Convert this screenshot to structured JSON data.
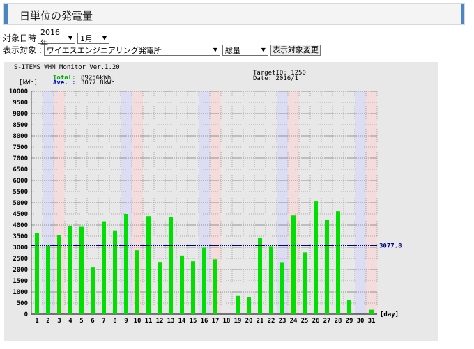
{
  "page": {
    "title": "日単位の発電量"
  },
  "controls": {
    "period_label": "対象日時",
    "year_value": "2016年",
    "month_value": "1月",
    "target_label": "表示対象 :",
    "target_value": "ワイエスエンジニアリング発電所",
    "kind_value": "総量",
    "change_button": "表示対象変更"
  },
  "chart_header": {
    "app": "S-ITEMS WHM Monitor Ver.1.20",
    "unit": "[kWh]",
    "total_label": "Total:",
    "total_value": "89256kWh",
    "ave_label": "Ave.  :",
    "ave_value": "3077.8kWh",
    "target_id": "TargetID: 1250",
    "date": "Date: 2016/1"
  },
  "colors": {
    "bar": "#00e000",
    "saturday": "#dcdcf2",
    "sunday": "#f4dcdc",
    "average_line": "#000080",
    "accent": "#4a86c5"
  },
  "chart_data": {
    "type": "bar",
    "xlabel": "[day]",
    "ylabel": "[kWh]",
    "ylim": [
      0,
      10000
    ],
    "yticks": [
      "0",
      "500",
      "1000",
      "1500",
      "2000",
      "2500",
      "3000",
      "3500",
      "4000",
      "4500",
      "5000",
      "5500",
      "6000",
      "6500",
      "7000",
      "7500",
      "8000",
      "8500",
      "9000",
      "9500",
      "10000"
    ],
    "categories": [
      "1",
      "2",
      "3",
      "4",
      "5",
      "6",
      "7",
      "8",
      "9",
      "10",
      "11",
      "12",
      "13",
      "14",
      "15",
      "16",
      "17",
      "18",
      "19",
      "20",
      "21",
      "22",
      "23",
      "24",
      "25",
      "26",
      "27",
      "28",
      "29",
      "30",
      "31"
    ],
    "values": [
      3650,
      3080,
      3560,
      3970,
      3920,
      2090,
      4170,
      3760,
      4500,
      2870,
      4400,
      2340,
      4370,
      2630,
      2370,
      2980,
      2460,
      0,
      820,
      750,
      3420,
      3050,
      2330,
      4430,
      2770,
      5060,
      4220,
      4620,
      640,
      0,
      200
    ],
    "saturdays": [
      2,
      9,
      16,
      23,
      30
    ],
    "sundays": [
      3,
      10,
      17,
      24,
      31
    ],
    "average": 3077.8,
    "average_label": "3077.8",
    "grid": true
  }
}
